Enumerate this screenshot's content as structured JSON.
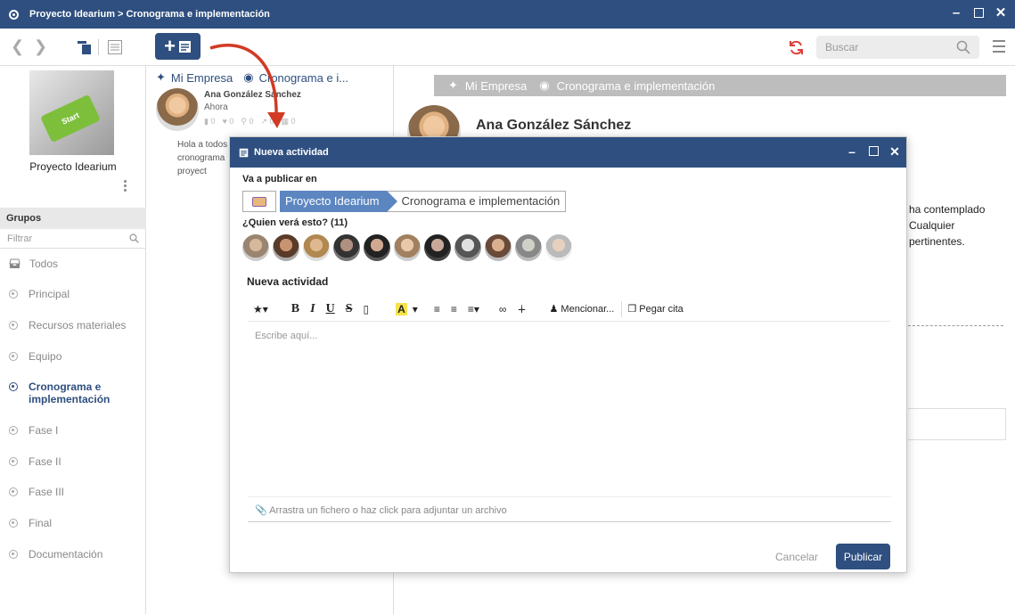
{
  "window": {
    "title": "Proyecto Idearium > Cronograma e implementación"
  },
  "toolbar": {
    "search_placeholder": "Buscar"
  },
  "sidebar": {
    "project_name": "Proyecto Idearium",
    "project_image_text": "Start",
    "groups_header": "Grupos",
    "filter_placeholder": "Filtrar",
    "items": [
      {
        "label": "Todos"
      },
      {
        "label": "Principal"
      },
      {
        "label": "Recursos materiales"
      },
      {
        "label": "Equipo"
      },
      {
        "label": "Cronograma e implementación",
        "active": true
      },
      {
        "label": "Fase I"
      },
      {
        "label": "Fase II"
      },
      {
        "label": "Fase III"
      },
      {
        "label": "Final"
      },
      {
        "label": "Documentación"
      }
    ]
  },
  "feed": {
    "crumb_company": "Mi Empresa",
    "crumb_group": "Cronograma e i...",
    "post": {
      "author": "Ana González Sánchez",
      "time": "Ahora",
      "comments": "0",
      "likes": "0",
      "attachments": "0",
      "shares": "0",
      "events": "0",
      "text_lines": [
        "Hola a todos",
        "cronograma",
        "proyect"
      ]
    }
  },
  "detail": {
    "crumb_company": "Mi Empresa",
    "crumb_group": "Cronograma e implementación",
    "author": "Ana González Sánchez",
    "text_lines": [
      "ha contemplado",
      "Cualquier",
      "pertinentes."
    ]
  },
  "modal": {
    "title": "Nueva actividad",
    "publish_in_label": "Va a publicar en",
    "breadcrumb": [
      "Proyecto Idearium",
      "Cronograma e implementación"
    ],
    "audience_label": "¿Quien verá esto? (11)",
    "section_label": "Nueva actividad",
    "mention_label": "Mencionar...",
    "quote_label": "Pegar cita",
    "editor_placeholder": "Escribe aquí...",
    "attach_text": "Arrastra un fichero o haz click para adjuntar un archivo",
    "cancel_label": "Cancelar",
    "publish_label": "Publicar"
  },
  "colors": {
    "primary": "#2e4f7f",
    "breadcrumb_active": "#5b86c0",
    "refresh": "#e0403a"
  }
}
